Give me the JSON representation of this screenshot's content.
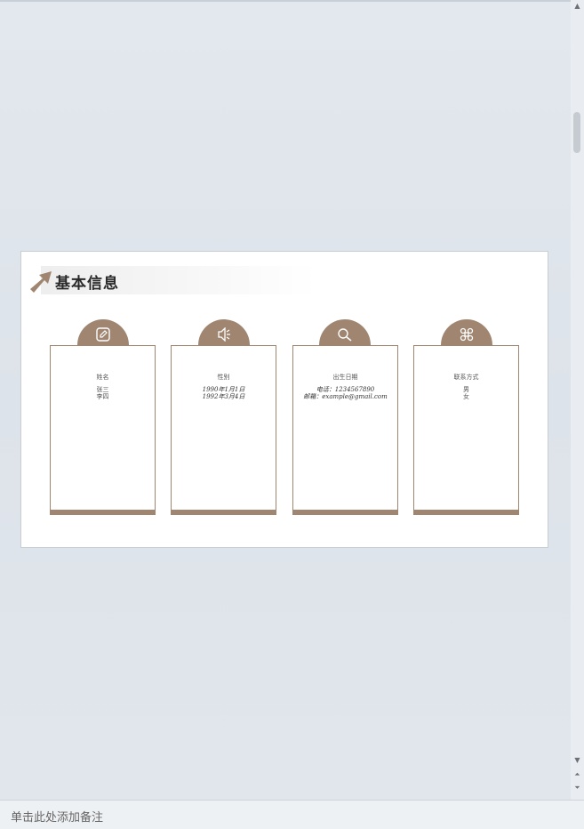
{
  "slide": {
    "title": "基本信息",
    "accent_color": "#a08570",
    "cards": [
      {
        "icon": "edit-icon",
        "heading": "姓名",
        "lines": [
          "张三",
          "李四"
        ],
        "style": "plain"
      },
      {
        "icon": "speaker-icon",
        "heading": "性别",
        "lines": [
          "1990年1月1日",
          "1992年3月4日"
        ],
        "style": "hand"
      },
      {
        "icon": "search-icon",
        "heading": "出生日期",
        "lines": [
          "电话：1234567890",
          "邮箱：example@gmail.com"
        ],
        "style": "hand"
      },
      {
        "icon": "command-icon",
        "heading": "联系方式",
        "lines": [
          "男",
          "女"
        ],
        "style": "plain"
      }
    ]
  },
  "notes": {
    "placeholder": "单击此处添加备注"
  },
  "scrollbar": {
    "up": "▲",
    "down": "▼",
    "page_up": "⏶",
    "page_down": "⏷"
  }
}
